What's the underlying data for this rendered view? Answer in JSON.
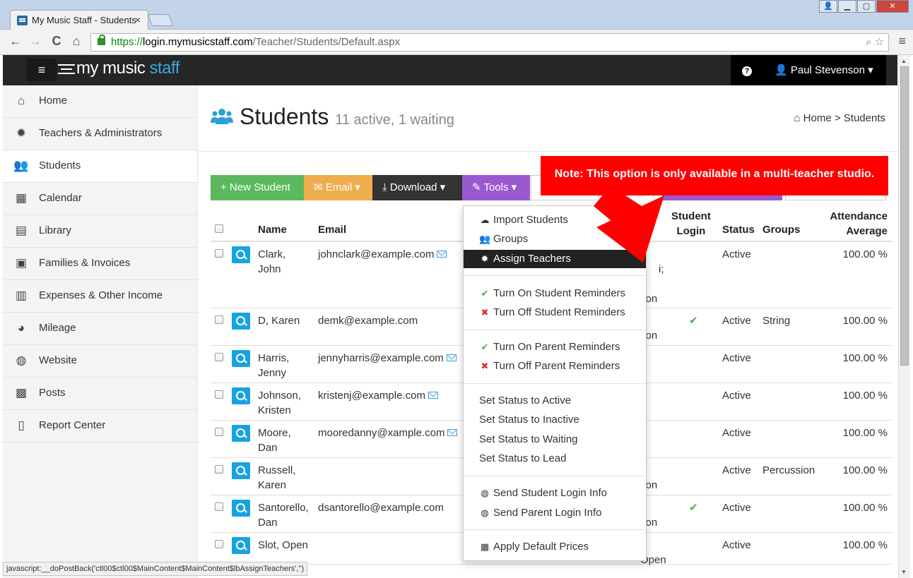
{
  "browser": {
    "tab_title": "My Music Staff - Students",
    "tab_close": "×",
    "url_scheme": "https://",
    "url_host": "login.mymusicstaff.com",
    "url_path": "/Teacher/Students/Default.aspx",
    "back": "←",
    "forward": "→",
    "reload": "C",
    "home": "⌂",
    "zoom": "⌕",
    "star": "☆",
    "menu": "≡",
    "win_min": "▁",
    "win_max": "▢",
    "win_close": "✕",
    "user_icon": "👤",
    "status_text": "javascript:__doPostBack('ctl00$ctl00$MainContent$MainContent$lbAssignTeachers','')"
  },
  "navbar": {
    "hamburger": "≡",
    "logo_part1": "my music",
    "logo_part2": " staff",
    "help": "?",
    "user_name": "Paul Stevenson",
    "user_caret": "▾",
    "colors": {
      "background": "#262626",
      "logo_accent": "#3aa7e3"
    }
  },
  "sidebar": {
    "items": [
      {
        "label": "Home",
        "icon": "home-icon",
        "glyph": "⌂"
      },
      {
        "label": "Teachers & Administrators",
        "icon": "gear-icon",
        "glyph": "✹"
      },
      {
        "label": "Students",
        "icon": "users-icon",
        "glyph": "👥"
      },
      {
        "label": "Calendar",
        "icon": "calendar-icon",
        "glyph": "▦"
      },
      {
        "label": "Library",
        "icon": "book-icon",
        "glyph": "▤"
      },
      {
        "label": "Families & Invoices",
        "icon": "money-icon",
        "glyph": "▣"
      },
      {
        "label": "Expenses & Other Income",
        "icon": "bar-chart-icon",
        "glyph": "▥"
      },
      {
        "label": "Mileage",
        "icon": "dashboard-icon",
        "glyph": "◕"
      },
      {
        "label": "Website",
        "icon": "globe-icon",
        "glyph": "◍"
      },
      {
        "label": "Posts",
        "icon": "newspaper-icon",
        "glyph": "▩"
      },
      {
        "label": "Report Center",
        "icon": "file-icon",
        "glyph": "▯"
      }
    ]
  },
  "header": {
    "title": "Students",
    "subtitle": "11 active, 1 waiting",
    "breadcrumb_home": "Home",
    "breadcrumb_sep": " > ",
    "breadcrumb_current": "Students"
  },
  "buttons": {
    "new_student": "+ New Student",
    "email": "✉ Email ▾",
    "download": "⤓ Download ▾",
    "tools": "✎ Tools ▾",
    "colors": {
      "new": "#5cb85c",
      "email": "#f0ad4e",
      "download": "#333333",
      "tools": "#9b59d0"
    }
  },
  "table": {
    "headers": {
      "name": "Name",
      "email": "Email",
      "teachers_partial": "ers",
      "student_login": "Student\nLogin",
      "status": "Status",
      "groups": "Groups",
      "attendance": "Attendance\nAverage"
    },
    "rows": [
      {
        "name": "Clark,\nJohn",
        "email": "johnclark@example.com",
        "has_mail": true,
        "teacher_frag": "i;",
        "teacher_frag2": "son",
        "login": "",
        "status": "Active",
        "groups": "",
        "attendance": "100.00 %"
      },
      {
        "name": "D, Karen",
        "email": "demk@example.com",
        "has_mail": false,
        "teacher_frag": "",
        "teacher_frag2": "son",
        "login": "✔",
        "status": "Active",
        "groups": "String",
        "attendance": "100.00 %"
      },
      {
        "name": "Harris,\nJenny",
        "email": "jennyharris@example.com",
        "has_mail": true,
        "teacher_frag": "",
        "teacher_frag2": "",
        "login": "",
        "status": "Active",
        "groups": "",
        "attendance": "100.00 %"
      },
      {
        "name": "Johnson,\nKristen",
        "email": "kristenj@example.com",
        "has_mail": true,
        "teacher_frag": "",
        "teacher_frag2": "",
        "login": "",
        "status": "Active",
        "groups": "",
        "attendance": "100.00 %"
      },
      {
        "name": "Moore,\nDan",
        "email": "mooredanny@xample.com",
        "has_mail": true,
        "teacher_frag": "",
        "teacher_frag2": "",
        "login": "",
        "status": "Active",
        "groups": "",
        "attendance": "100.00 %"
      },
      {
        "name": "Russell,\nKaren",
        "email": "",
        "has_mail": false,
        "teacher_frag": "",
        "teacher_frag2": "son",
        "login": "",
        "status": "Active",
        "groups": "Percussion",
        "attendance": "100.00 %"
      },
      {
        "name": "Santorello,\nDan",
        "email": "dsantorello@example.com",
        "has_mail": false,
        "teacher_frag": "",
        "teacher_frag2": "son",
        "login": "✔",
        "status": "Active",
        "groups": "",
        "attendance": "100.00 %"
      },
      {
        "name": "Slot, Open",
        "email": "",
        "has_mail": false,
        "teacher_frag": "",
        "teacher_frag2": "Open",
        "login": "",
        "status": "Active",
        "groups": "",
        "attendance": "100.00 %"
      }
    ]
  },
  "tools_menu": {
    "import_students": "Import Students",
    "groups": "Groups",
    "assign_teachers": "Assign Teachers",
    "turn_on_student": "Turn On Student Reminders",
    "turn_off_student": "Turn Off Student Reminders",
    "turn_on_parent": "Turn On Parent Reminders",
    "turn_off_parent": "Turn Off Parent Reminders",
    "status_active": "Set Status to Active",
    "status_inactive": "Set Status to Inactive",
    "status_waiting": "Set Status to Waiting",
    "status_lead": "Set Status to Lead",
    "send_student_login": "Send Student Login Info",
    "send_parent_login": "Send Parent Login Info",
    "apply_prices": "Apply Default Prices",
    "glyph_import": "☁",
    "glyph_groups": "👥",
    "glyph_assign": "✹",
    "glyph_check": "✔",
    "glyph_x": "✖",
    "glyph_globe": "◍",
    "glyph_calendar": "▦"
  },
  "callout": {
    "text": "Note: This option is only available in a multi-teacher studio.",
    "color": "#ff0000"
  }
}
